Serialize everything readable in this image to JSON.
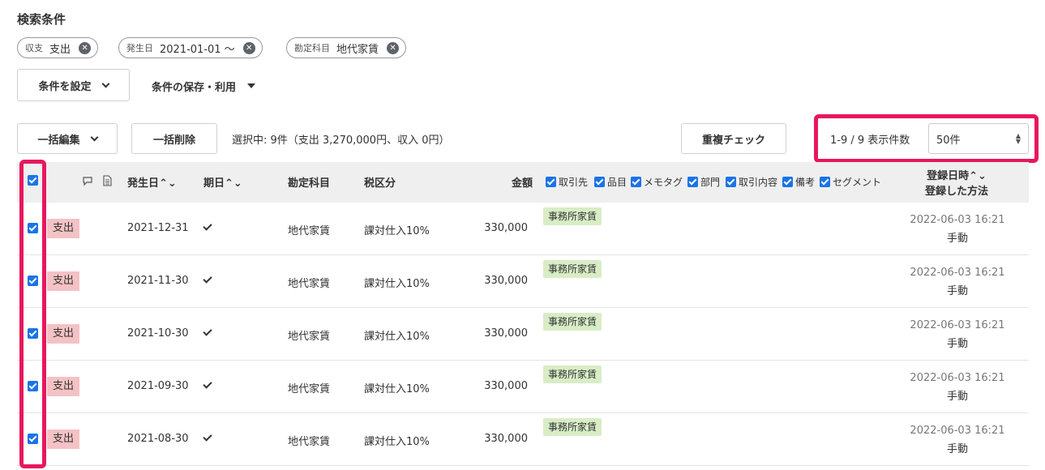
{
  "search": {
    "title": "検索条件",
    "chips": [
      {
        "label": "収支",
        "value": "支出"
      },
      {
        "label": "発生日",
        "value": "2021-01-01 ～"
      },
      {
        "label": "勘定科目",
        "value": "地代家賃"
      }
    ],
    "set_conditions": "条件を設定",
    "save_use": "条件の保存・利用"
  },
  "toolbar": {
    "bulk_edit": "一括編集",
    "bulk_delete": "一括削除",
    "selection_info": "選択中: 9件（支出 3,270,000円、収入 0円）",
    "duplicate_check": "重複チェック",
    "range": "1-9 / 9  表示件数",
    "per_page": "50件"
  },
  "table": {
    "headers": {
      "date": "発生日",
      "due": "期日",
      "account": "勘定科目",
      "tax": "税区分",
      "amount": "金額",
      "registered_at": "登録日時",
      "registered_method": "登録した方法"
    },
    "column_toggles": [
      "取引先",
      "品目",
      "メモタグ",
      "部門",
      "取引内容",
      "備考",
      "セグメント"
    ],
    "rows": [
      {
        "type": "支出",
        "date": "2021-12-31",
        "account": "地代家賃",
        "tax": "課対仕入10%",
        "amount": "330,000",
        "tag": "事務所家賃",
        "registered_at": "2022-06-03 16:21",
        "method": "手動"
      },
      {
        "type": "支出",
        "date": "2021-11-30",
        "account": "地代家賃",
        "tax": "課対仕入10%",
        "amount": "330,000",
        "tag": "事務所家賃",
        "registered_at": "2022-06-03 16:21",
        "method": "手動"
      },
      {
        "type": "支出",
        "date": "2021-10-30",
        "account": "地代家賃",
        "tax": "課対仕入10%",
        "amount": "330,000",
        "tag": "事務所家賃",
        "registered_at": "2022-06-03 16:21",
        "method": "手動"
      },
      {
        "type": "支出",
        "date": "2021-09-30",
        "account": "地代家賃",
        "tax": "課対仕入10%",
        "amount": "330,000",
        "tag": "事務所家賃",
        "registered_at": "2022-06-03 16:21",
        "method": "手動"
      },
      {
        "type": "支出",
        "date": "2021-08-30",
        "account": "地代家賃",
        "tax": "課対仕入10%",
        "amount": "330,000",
        "tag": "事務所家賃",
        "registered_at": "2022-06-03 16:21",
        "method": "手動"
      }
    ]
  },
  "colors": {
    "highlight": "#e8175d",
    "expense_badge": "#f4c2c4",
    "tag_bg": "#d8edc6",
    "checkbox": "#1a73e8"
  }
}
